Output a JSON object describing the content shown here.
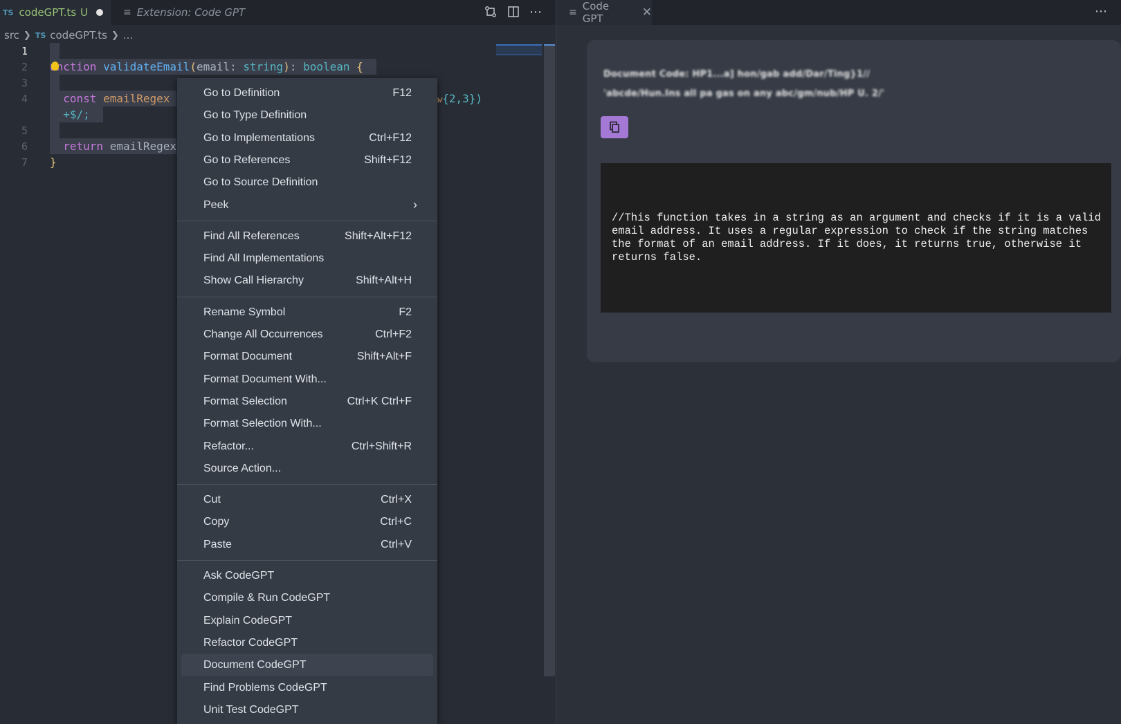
{
  "editor": {
    "tabs": [
      {
        "badge": "TS",
        "label": "codeGPT.ts",
        "status": "U"
      },
      {
        "label": "Extension: Code GPT"
      }
    ],
    "icons": [
      "compare-icon",
      "split-editor-icon",
      "more-actions-icon",
      "file-lines-icon"
    ],
    "breadcrumb": {
      "folder": "src",
      "badge": "TS",
      "file": "codeGPT.ts",
      "ellipsis": "..."
    },
    "line_numbers": [
      "1",
      "2",
      "3",
      "4",
      "5",
      "6",
      "7"
    ],
    "code": {
      "l2_kw": "function",
      "l2_kw_visible": "unction",
      "l2_fn": "validateEmail",
      "l2_open": "(",
      "l2_param": "email",
      "l2_colon": ": ",
      "l2_type": "string",
      "l2_close": ")",
      "l2_colon2": ": ",
      "l2_ret": "boolean",
      "l2_brace": "{",
      "l4_kw": "const",
      "l4_var": "emailRegex",
      "l4_tail_a": "w",
      "l4_tail_b": "{2,3})",
      "l4b": "+$/;",
      "l6_kw": "return",
      "l6_var": "emailRegex",
      "l7": "}"
    }
  },
  "menu": {
    "groups": [
      [
        {
          "label": "Go to Definition",
          "key": "F12"
        },
        {
          "label": "Go to Type Definition",
          "key": ""
        },
        {
          "label": "Go to Implementations",
          "key": "Ctrl+F12"
        },
        {
          "label": "Go to References",
          "key": "Shift+F12"
        },
        {
          "label": "Go to Source Definition",
          "key": ""
        },
        {
          "label": "Peek",
          "key": ""
        }
      ],
      [
        {
          "label": "Find All References",
          "key": "Shift+Alt+F12"
        },
        {
          "label": "Find All Implementations",
          "key": ""
        },
        {
          "label": "Show Call Hierarchy",
          "key": "Shift+Alt+H"
        }
      ],
      [
        {
          "label": "Rename Symbol",
          "key": "F2"
        },
        {
          "label": "Change All Occurrences",
          "key": "Ctrl+F2"
        },
        {
          "label": "Format Document",
          "key": "Shift+Alt+F"
        },
        {
          "label": "Format Document With...",
          "key": ""
        },
        {
          "label": "Format Selection",
          "key": "Ctrl+K Ctrl+F"
        },
        {
          "label": "Format Selection With...",
          "key": ""
        },
        {
          "label": "Refactor...",
          "key": "Ctrl+Shift+R"
        },
        {
          "label": "Source Action...",
          "key": ""
        }
      ],
      [
        {
          "label": "Cut",
          "key": "Ctrl+X"
        },
        {
          "label": "Copy",
          "key": "Ctrl+C"
        },
        {
          "label": "Paste",
          "key": "Ctrl+V"
        }
      ],
      [
        {
          "label": "Ask CodeGPT",
          "key": ""
        },
        {
          "label": "Compile & Run CodeGPT",
          "key": ""
        },
        {
          "label": "Explain CodeGPT",
          "key": ""
        },
        {
          "label": "Refactor CodeGPT",
          "key": ""
        },
        {
          "label": "Document CodeGPT",
          "key": "",
          "highlighted": true
        },
        {
          "label": "Find Problems CodeGPT",
          "key": ""
        },
        {
          "label": "Unit Test CodeGPT",
          "key": ""
        }
      ]
    ]
  },
  "panel": {
    "tab_label": "Code GPT",
    "blurred_line1": "Document Code: HP1...a] hon/gab add/Dar/Ting}1//",
    "blurred_line2": "'abcde/Hun.Ins all pa gas on any abc/gm/nub/HP U. 2/'",
    "output": "//This function takes in a string as an argument and checks if it is a valid email address. It uses a regular expression to check if the string matches the format of an email address. If it does, it returns true, otherwise it returns false."
  }
}
